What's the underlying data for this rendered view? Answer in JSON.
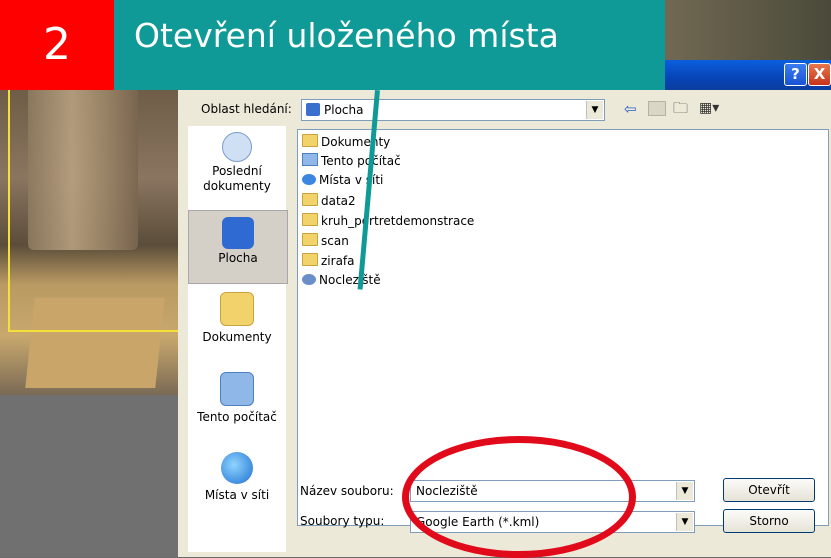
{
  "overlay": {
    "step_number": "2",
    "step_title": "Otevření uloženého místa"
  },
  "dialog": {
    "title_buttons": {
      "help": "?",
      "close": "X"
    },
    "look_in": {
      "label": "Oblast hledání:",
      "value": "Plocha"
    },
    "places": [
      "Poslední dokumenty",
      "Plocha",
      "Dokumenty",
      "Tento počítač",
      "Místa v síti"
    ],
    "files": [
      "Dokumenty",
      "Tento počítač",
      "Místa v síti",
      "data2",
      "kruh_portretdemonstrace",
      "scan",
      "zirafa",
      "Nocleziště"
    ],
    "filename": {
      "label": "Název souboru:",
      "value": "Nocleziště"
    },
    "filetype": {
      "label": "Soubory typu:",
      "value": "Google Earth (*.kml)"
    },
    "buttons": {
      "open": "Otevřít",
      "cancel": "Storno"
    }
  }
}
